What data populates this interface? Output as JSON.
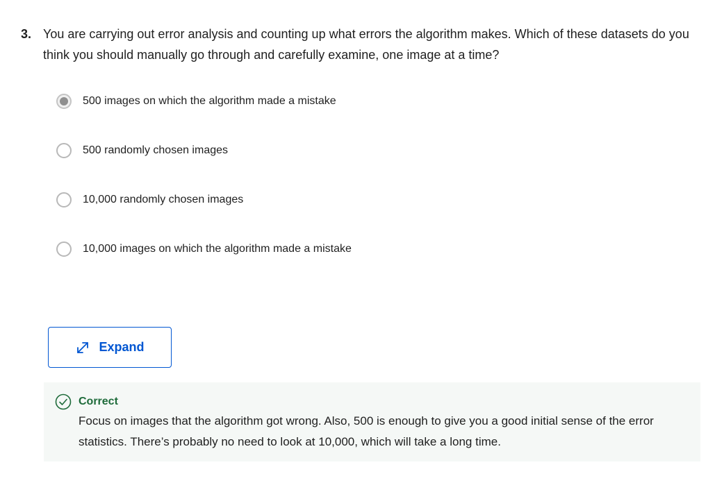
{
  "question": {
    "number": "3.",
    "text": "You are carrying out error analysis and counting up what errors the algorithm makes. Which of these datasets do you think you should manually go through and carefully examine, one image at a time?"
  },
  "options": [
    {
      "label": "500 images on which the algorithm made a mistake",
      "selected": true
    },
    {
      "label": "500 randomly chosen images",
      "selected": false
    },
    {
      "label": "10,000 randomly chosen images",
      "selected": false
    },
    {
      "label": "10,000 images on which the algorithm made a mistake",
      "selected": false
    }
  ],
  "expand": {
    "label": "Expand",
    "icon": "expand-arrows-icon"
  },
  "feedback": {
    "status": "Correct",
    "icon": "check-circle-icon",
    "text": "Focus on images that the algorithm got wrong. Also, 500 is enough to give you a good initial sense of the error statistics. There’s probably no need to look at 10,000, which will take a long time."
  },
  "colors": {
    "accent": "#0056d2",
    "correct": "#1e6b3a",
    "feedback_bg": "#f5f8f6"
  }
}
